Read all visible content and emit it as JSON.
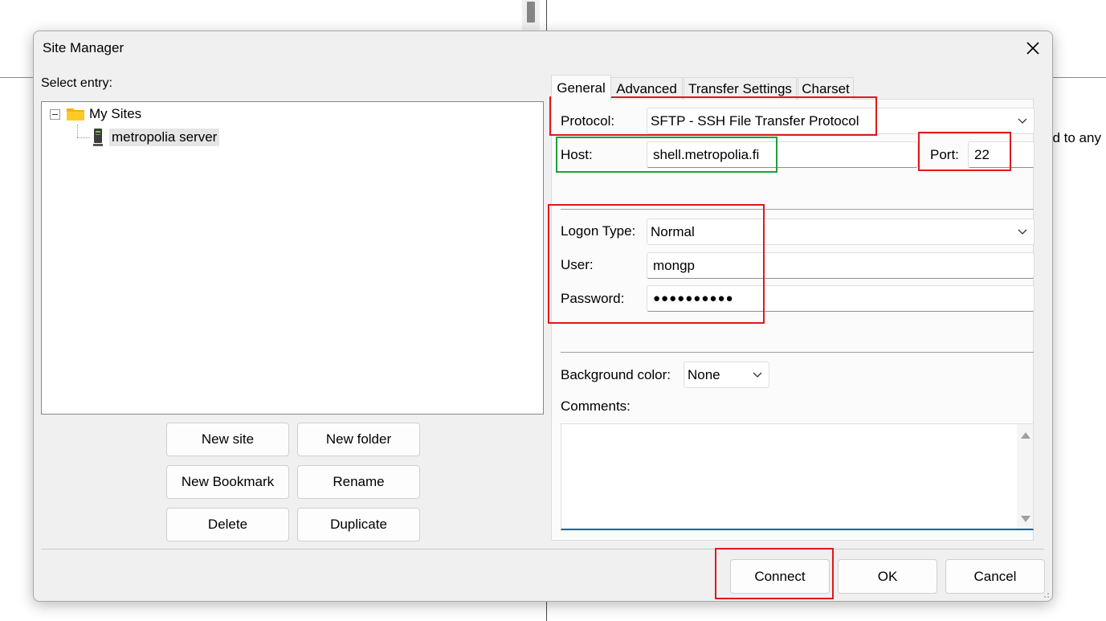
{
  "background": {
    "partial_text": "ed to any"
  },
  "dialog": {
    "title": "Site Manager",
    "close_icon": "close-icon"
  },
  "left": {
    "select_entry_label": "Select entry:",
    "tree": {
      "root_label": "My Sites",
      "root_icon": "folder-icon",
      "child_label": "metropolia server",
      "child_icon": "server-icon"
    },
    "buttons": {
      "new_site": "New site",
      "new_folder": "New folder",
      "new_bookmark": "New Bookmark",
      "rename": "Rename",
      "delete": "Delete",
      "duplicate": "Duplicate"
    }
  },
  "tabs": [
    "General",
    "Advanced",
    "Transfer Settings",
    "Charset"
  ],
  "active_tab": "General",
  "general": {
    "protocol_label": "Protocol:",
    "protocol_value": "SFTP - SSH File Transfer Protocol",
    "host_label": "Host:",
    "host_value": "shell.metropolia.fi",
    "port_label": "Port:",
    "port_value": "22",
    "logon_type_label": "Logon Type:",
    "logon_type_value": "Normal",
    "user_label": "User:",
    "user_value": "mongp",
    "password_label": "Password:",
    "password_value": "●●●●●●●●●●",
    "bg_color_label": "Background color:",
    "bg_color_value": "None",
    "comments_label": "Comments:",
    "comments_value": ""
  },
  "footer": {
    "connect": "Connect",
    "ok": "OK",
    "cancel": "Cancel"
  },
  "colors": {
    "highlight_red": "#e0181b",
    "highlight_green": "#1fa03b",
    "accent": "#0063b1"
  }
}
